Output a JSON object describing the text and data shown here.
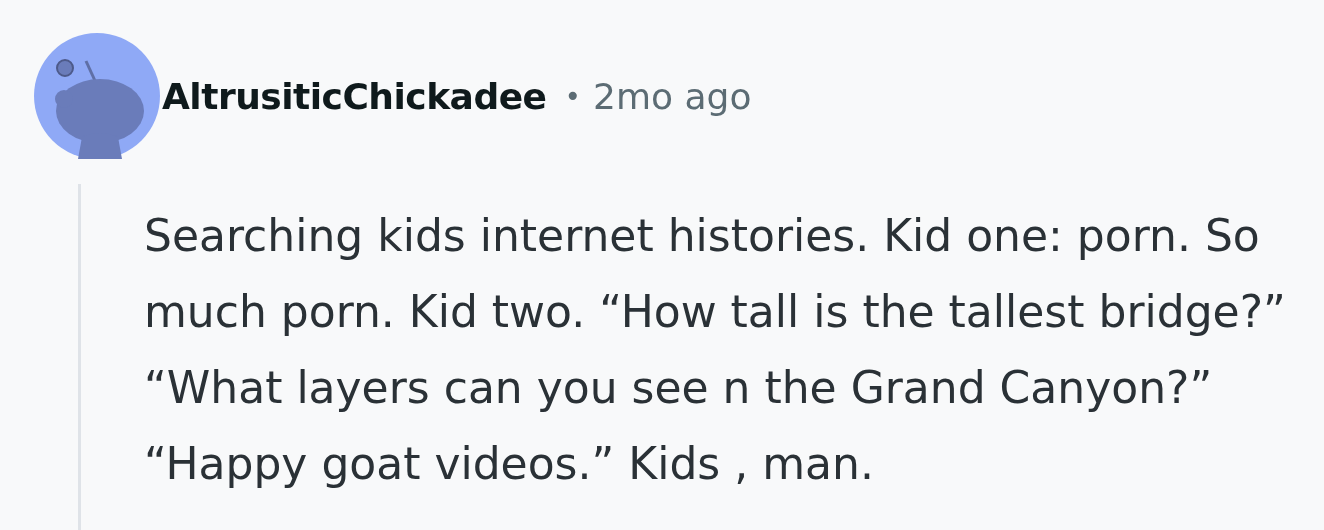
{
  "comment": {
    "author": "AltrusiticChickadee",
    "separator": "•",
    "time": "2mo ago",
    "body": "Searching kids internet histories. Kid one: porn. So much porn. Kid two. “How tall is the tallest bridge?” “What layers can you see n the Grand Canyon?” “Happy goat videos.” Kids , man."
  }
}
